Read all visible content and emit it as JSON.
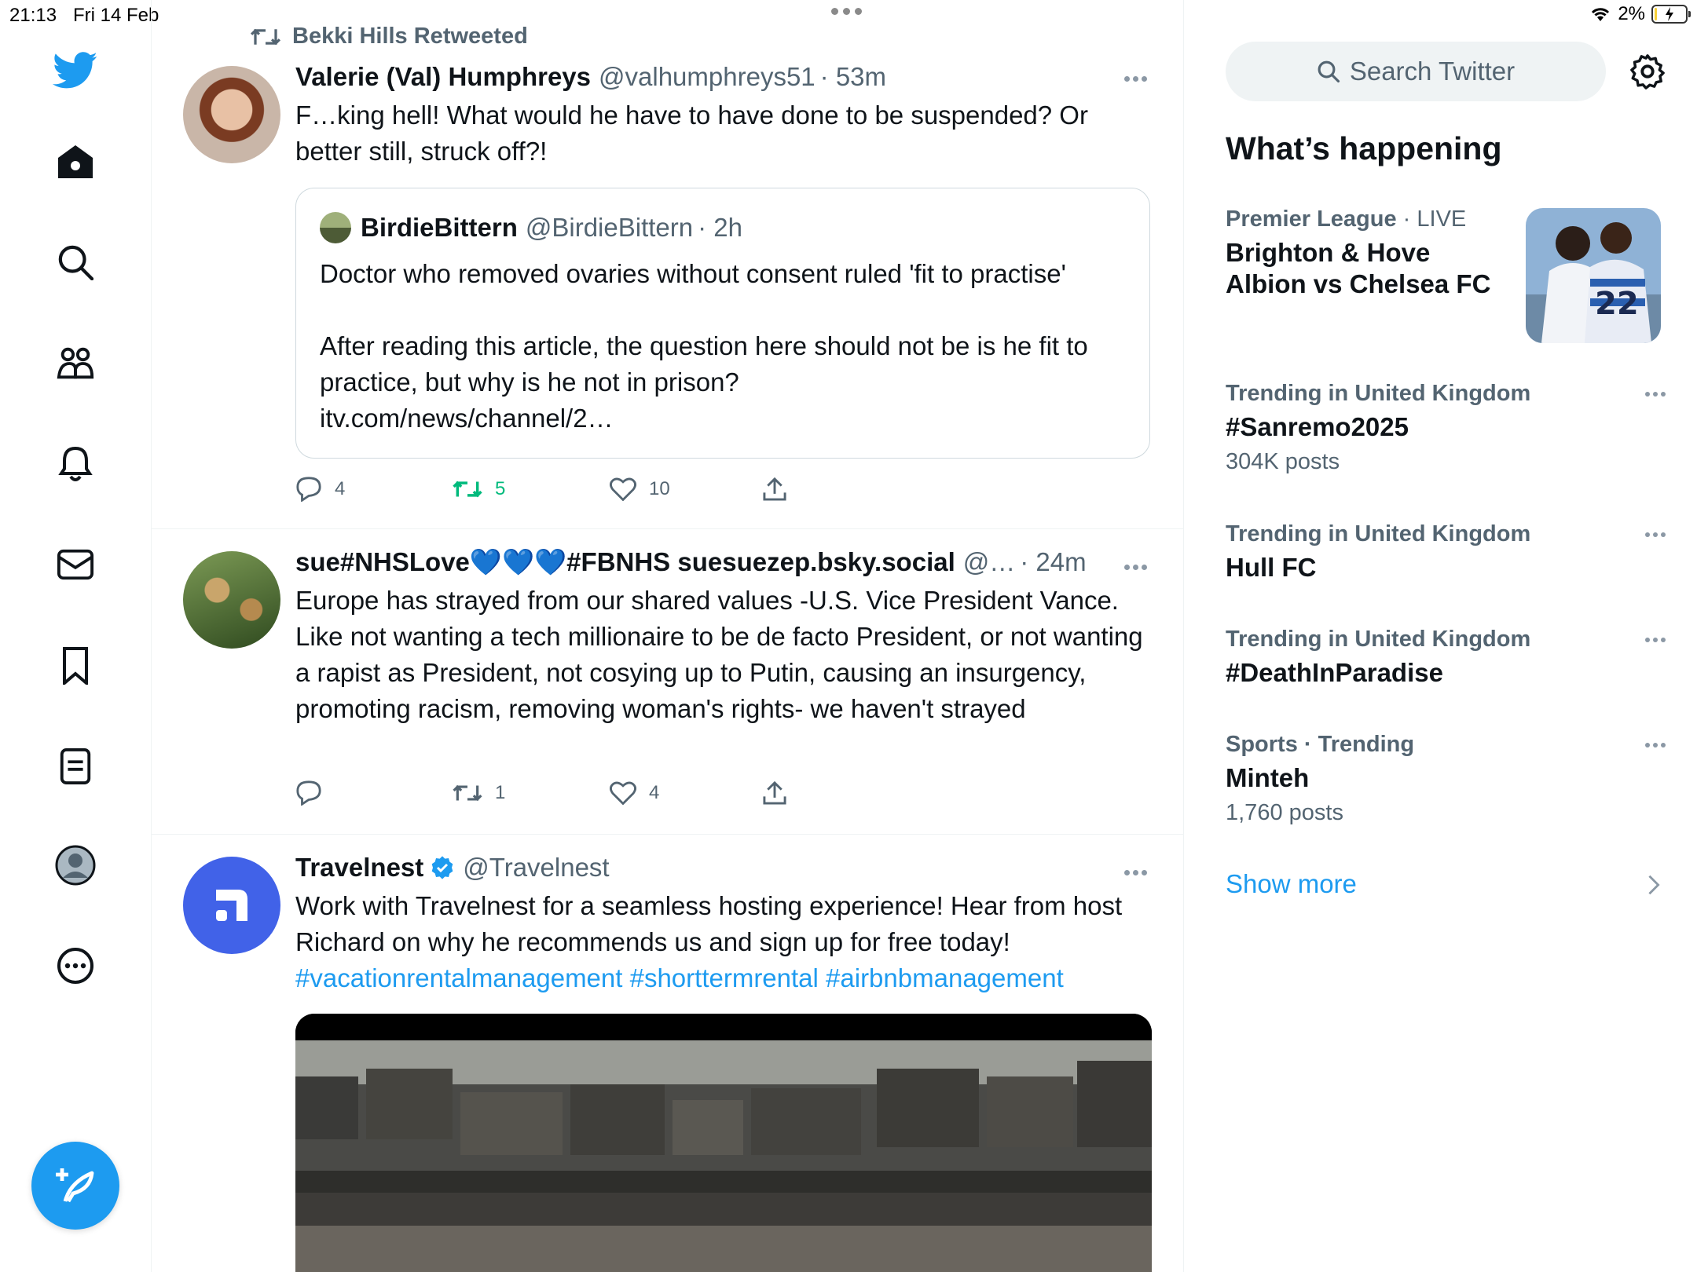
{
  "status_bar": {
    "time": "21:13",
    "date": "Fri 14 Feb",
    "battery": "2%",
    "battery_level": 0.02
  },
  "nav": {
    "items": [
      {
        "icon": "twitter-logo-icon"
      },
      {
        "icon": "home-icon"
      },
      {
        "icon": "search-icon"
      },
      {
        "icon": "communities-icon"
      },
      {
        "icon": "bell-icon"
      },
      {
        "icon": "mail-icon"
      },
      {
        "icon": "bookmark-icon"
      },
      {
        "icon": "lists-icon"
      },
      {
        "icon": "profile-icon"
      },
      {
        "icon": "more-circle-icon"
      }
    ],
    "compose_icon": "compose-feather-icon",
    "accent": "#1d9bf0"
  },
  "timeline": {
    "tweets": [
      {
        "social_context": "Bekki Hills Retweeted",
        "name": "Valerie (Val) Humphreys",
        "handle": "@valhumphreys51",
        "time": "· 53m",
        "text": "F…king hell! What would he have to have done to be suspended? Or better still, struck off?!",
        "quote": {
          "name": "BirdieBittern",
          "handle": "@BirdieBittern",
          "time": "· 2h",
          "text": "Doctor who removed ovaries without consent ruled 'fit to practise'\n\nAfter reading this article, the question here should not be is he fit to practice, but why is he not in prison?\nitv.com/news/channel/2…"
        },
        "replies": "4",
        "retweets": "5",
        "likes": "10",
        "retweeted": true
      },
      {
        "name": "sue#NHSLove💙💙💙#FBNHS suesuezep.bsky.social",
        "handle": "@…",
        "time": "· 24m",
        "text": "Europe has strayed from our shared values -U.S. Vice President Vance. Like not wanting a tech millionaire to be de facto President, or not wanting a rapist as President, not cosying up to Putin, causing an insurgency, promoting racism, removing woman's rights- we haven't strayed",
        "replies": "",
        "retweets": "1",
        "likes": "4"
      },
      {
        "name": "Travelnest",
        "verified": true,
        "handle": "@Travelnest",
        "text": "Work with Travelnest for a seamless hosting experience! Hear from host Richard on why he recommends us and sign up for free today!",
        "hashtags": "#vacationrentalmanagement #shorttermrental #airbnbmanagement"
      }
    ]
  },
  "sidebar": {
    "search_placeholder": "Search Twitter",
    "title": "What’s happening",
    "trends": [
      {
        "category": "Premier League",
        "live": "· LIVE",
        "name": "Brighton & Hove Albion vs Chelsea FC",
        "count": ""
      },
      {
        "category": "Trending in United Kingdom",
        "name": "#Sanremo2025",
        "count": "304K posts"
      },
      {
        "category": "Trending in United Kingdom",
        "name": "Hull FC",
        "count": ""
      },
      {
        "category": "Trending in United Kingdom",
        "name": "#DeathInParadise",
        "count": ""
      },
      {
        "category": "Sports · Trending",
        "name": "Minteh",
        "count": "1,760 posts"
      }
    ],
    "show_more": "Show more"
  }
}
